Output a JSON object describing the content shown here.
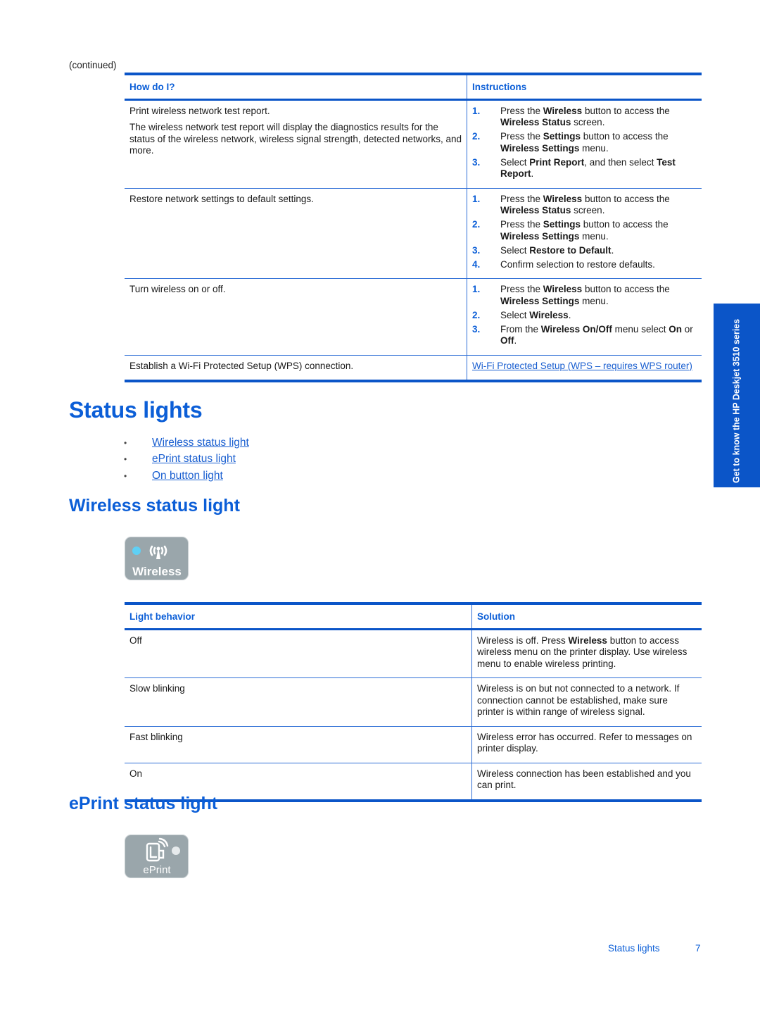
{
  "continued_label": "(continued)",
  "howto_table": {
    "headers": [
      "How do I?",
      "Instructions"
    ],
    "rows": [
      {
        "task": [
          "Print wireless network test report.",
          "The wireless network test report will display the diagnostics results for the status of the wireless network, wireless signal strength, detected networks, and more."
        ],
        "steps": [
          {
            "n": "1.",
            "html": "Press the <b>Wireless</b> button to access the <b>Wireless Status</b> screen."
          },
          {
            "n": "2.",
            "html": "Press the <b>Settings</b> button to access the <b>Wireless Settings</b> menu."
          },
          {
            "n": "3.",
            "html": "Select <b>Print Report</b>, and then select <b>Test Report</b>."
          }
        ]
      },
      {
        "task": [
          "Restore network settings to default settings."
        ],
        "steps": [
          {
            "n": "1.",
            "html": "Press the <b>Wireless</b> button to access the <b>Wireless Status</b> screen."
          },
          {
            "n": "2.",
            "html": "Press the <b>Settings</b> button to access the <b>Wireless Settings</b> menu."
          },
          {
            "n": "3.",
            "html": "Select <b>Restore to Default</b>."
          },
          {
            "n": "4.",
            "html": "Confirm selection to restore defaults."
          }
        ]
      },
      {
        "task": [
          "Turn wireless on or off."
        ],
        "steps": [
          {
            "n": "1.",
            "html": "Press the <b>Wireless</b> button to access the <b>Wireless Settings</b> menu."
          },
          {
            "n": "2.",
            "html": "Select <b>Wireless</b>."
          },
          {
            "n": "3.",
            "html": "From the <b>Wireless On/Off</b> menu select <b>On</b> or <b>Off</b>."
          }
        ]
      },
      {
        "task": [
          "Establish a Wi-Fi Protected Setup (WPS) connection."
        ],
        "link": "Wi-Fi Protected Setup (WPS – requires WPS router)"
      }
    ]
  },
  "status_lights": {
    "title": "Status lights",
    "toc": [
      "Wireless status light",
      "ePrint status light",
      "On button light"
    ]
  },
  "wireless_section": {
    "heading": "Wireless status light",
    "icon_label": "Wireless",
    "indicator_color": "#5fd0f5",
    "table": {
      "headers": [
        "Light behavior",
        "Solution"
      ],
      "rows": [
        {
          "behavior": "Off",
          "solution": "Wireless is off. Press <b>Wireless</b> button to access wireless menu on the printer display. Use wireless menu to enable wireless printing."
        },
        {
          "behavior": "Slow blinking",
          "solution": "Wireless is on but not connected to a network. If connection cannot be established, make sure printer is within range of wireless signal."
        },
        {
          "behavior": "Fast blinking",
          "solution": "Wireless error has occurred. Refer to messages on printer display."
        },
        {
          "behavior": "On",
          "solution": "Wireless connection has been established and you can print."
        }
      ]
    }
  },
  "eprint_section": {
    "heading": "ePrint status light",
    "icon_label": "ePrint"
  },
  "side_tab": {
    "label": "Get to know the HP Deskjet 3510 series"
  },
  "footer": {
    "section": "Status lights",
    "page": "7"
  }
}
